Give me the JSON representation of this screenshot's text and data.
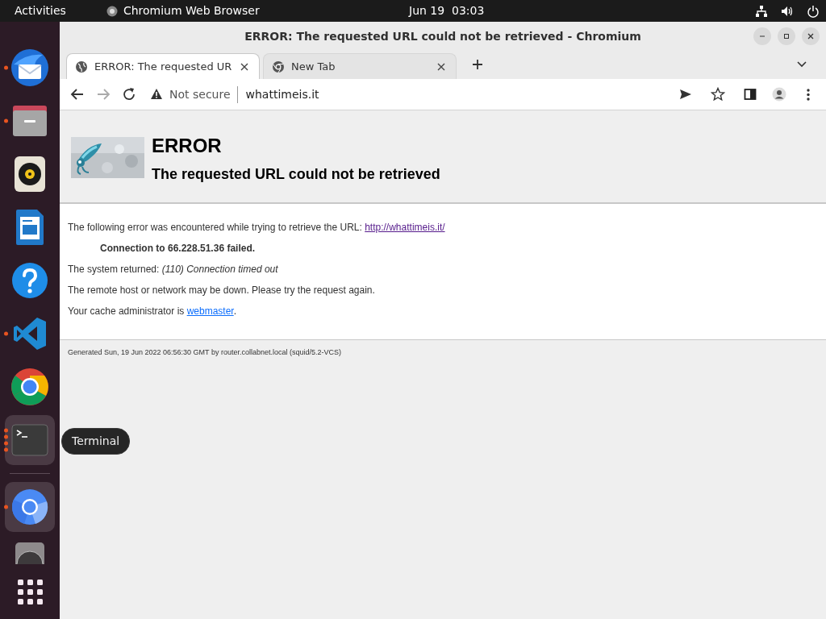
{
  "top_bar": {
    "activities": "Activities",
    "app_name": "Chromium Web Browser",
    "clock": "Jun 19  03:03"
  },
  "dock": {
    "items": [
      {
        "kind": "mail",
        "running": true,
        "multiple_windows": false,
        "highlighted": false
      },
      {
        "kind": "folder",
        "running": true,
        "multiple_windows": false,
        "highlighted": false
      },
      {
        "kind": "speaker",
        "running": false,
        "multiple_windows": false,
        "highlighted": false
      },
      {
        "kind": "document",
        "running": false,
        "multiple_windows": false,
        "highlighted": false
      },
      {
        "kind": "help",
        "running": false,
        "multiple_windows": false,
        "highlighted": false
      },
      {
        "kind": "code",
        "running": true,
        "multiple_windows": false,
        "highlighted": false
      },
      {
        "kind": "chrome",
        "running": false,
        "multiple_windows": false,
        "highlighted": false
      },
      {
        "kind": "terminal",
        "running": true,
        "multiple_windows": true,
        "highlighted": true
      },
      {
        "kind": "separator"
      },
      {
        "kind": "chromium",
        "running": true,
        "multiple_windows": false,
        "highlighted": true
      },
      {
        "kind": "drive",
        "running": false,
        "multiple_windows": false,
        "highlighted": false
      }
    ],
    "tooltip": "Terminal"
  },
  "window": {
    "title": "ERROR: The requested URL could not be retrieved - Chromium"
  },
  "tabs": [
    {
      "title": "ERROR: The requested UR",
      "selected": true
    },
    {
      "title": "New Tab",
      "selected": false
    }
  ],
  "address_bar": {
    "security": "Not secure",
    "url": "whattimeis.it"
  },
  "page": {
    "heading": "ERROR",
    "subheading": "The requested URL could not be retrieved",
    "intro": "The following error was encountered while trying to retrieve the URL: ",
    "intro_link": "http://whattimeis.it/",
    "error": "Connection to 66.228.51.36 failed.",
    "system": "The system returned: *(110) Connection timed out*",
    "advice": "The remote host or network may be down. Please try the request again.",
    "admin_text": "Your cache administrator is ",
    "admin_link": "webmaster",
    "admin_end": ".",
    "footer": "Generated Sun, 19 Jun 2022 06:56:30 GMT by router.collabnet.local (squid/5.2-VCS)"
  }
}
